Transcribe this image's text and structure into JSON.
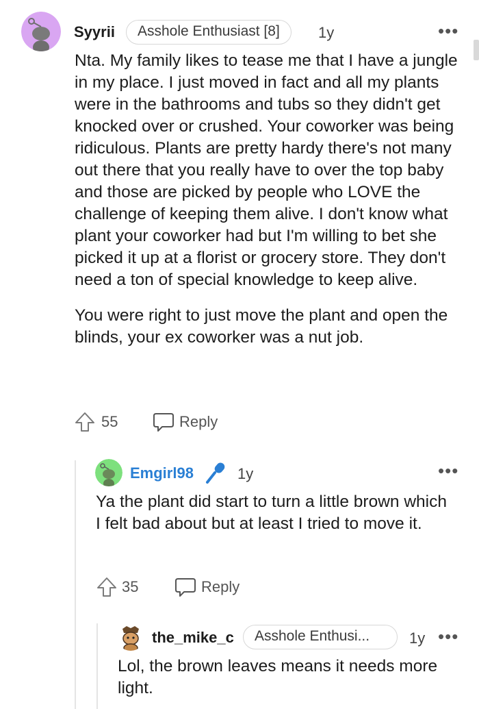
{
  "comments": [
    {
      "username": "Syyrii",
      "flair": "Asshole Enthusiast [8]",
      "age": "1y",
      "more": "•••",
      "paragraphs": [
        "Nta. My family likes to tease me that I have a jungle in my place. I just moved in fact and all my plants were in the bathrooms and tubs so they didn't get knocked over or crushed. Your coworker was being ridiculous. Plants are pretty hardy there's not many out there that you really have to over the top baby and those are picked by people who LOVE the challenge of keeping them alive. I don't know what plant your coworker had but I'm willing to bet she picked it up at a florist or grocery store. They don't need a ton of special knowledge to keep alive.",
        "You were right to just move the plant and open the blinds, your ex coworker was a nut job."
      ],
      "upvotes": "55",
      "reply_label": "Reply",
      "avatar_color": "#d9a6f2"
    },
    {
      "username": "Emgirl98",
      "age": "1y",
      "more": "•••",
      "text": "Ya the plant did start to turn a little brown which I felt bad about but at least I tried to move it.",
      "upvotes": "35",
      "reply_label": "Reply",
      "username_color": "#2a7fd4",
      "avatar_color": "#7de07d"
    },
    {
      "username": "the_mike_c",
      "flair": "Asshole Enthusi...",
      "age": "1y",
      "more": "•••",
      "text": "Lol, the brown leaves means it needs more light."
    }
  ]
}
